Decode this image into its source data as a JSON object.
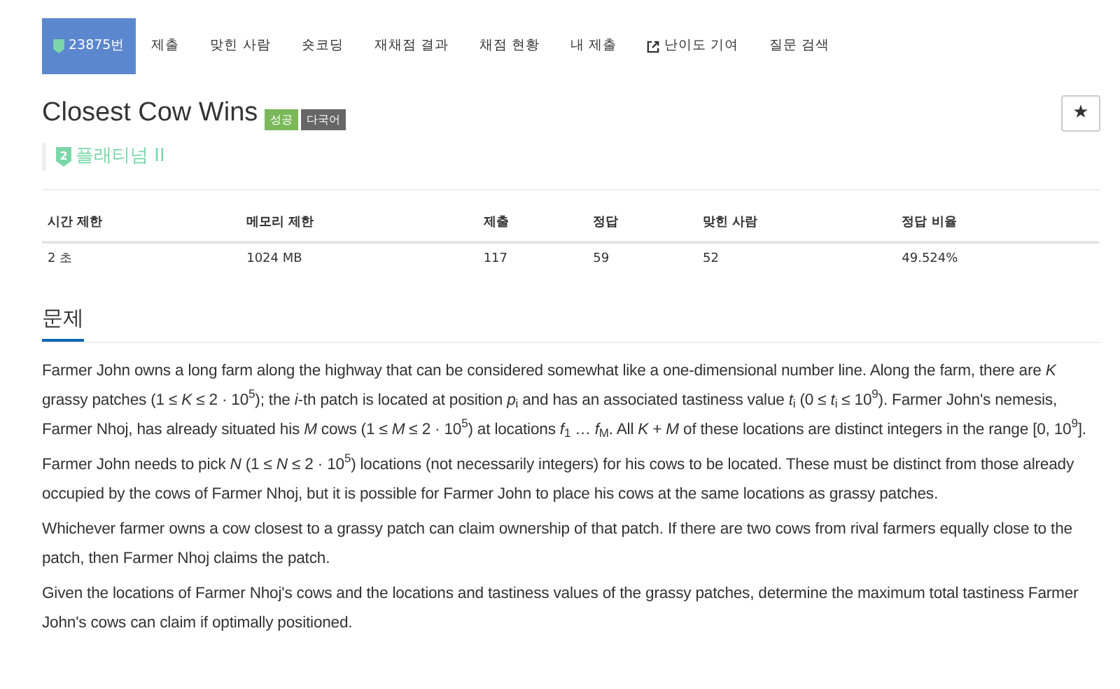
{
  "tabs": [
    {
      "label": "23875번",
      "selected": true,
      "kind": "problem"
    },
    {
      "label": "제출",
      "selected": false,
      "kind": "plain"
    },
    {
      "label": "맞힌 사람",
      "selected": false,
      "kind": "plain"
    },
    {
      "label": "숏코딩",
      "selected": false,
      "kind": "plain"
    },
    {
      "label": "재채점 결과",
      "selected": false,
      "kind": "plain"
    },
    {
      "label": "채점 현황",
      "selected": false,
      "kind": "plain"
    },
    {
      "label": "내 제출",
      "selected": false,
      "kind": "plain"
    },
    {
      "label": "난이도 기여",
      "selected": false,
      "kind": "external"
    },
    {
      "label": "질문 검색",
      "selected": false,
      "kind": "plain"
    }
  ],
  "title": "Closest Cow Wins",
  "badges": [
    {
      "label": "성공",
      "color": "#7ab85a"
    },
    {
      "label": "다국어",
      "color": "#666666"
    }
  ],
  "star_button": "★",
  "tier": {
    "label": "플래티넘 II",
    "icon_text": "2"
  },
  "table": {
    "columns": [
      "시간 제한",
      "메모리 제한",
      "제출",
      "정답",
      "맞힌 사람",
      "정답 비율"
    ],
    "rows": [
      [
        "2 초",
        "1024 MB",
        "117",
        "59",
        "52",
        "49.524%"
      ]
    ]
  },
  "section_title": "문제",
  "paragraphs": [
    "Farmer John owns a long farm along the highway that can be considered somewhat like a one-dimensional number line. Along the farm, there are *K* grassy patches (1 ≤ *K* ≤ 2 · 10$^{5}$); the *i*-th patch is located at position *p*$_{i}$ and has an associated tastiness value *t*$_{i}$ (0 ≤ *t*$_{i}$ ≤ 10$^{9}$). Farmer John's nemesis, Farmer Nhoj, has already situated his *M* cows (1 ≤ *M* ≤ 2 · 10$^{5}$) at locations *f*$_{1}$ … *f*$_{M}$. All *K* + *M* of these locations are distinct integers in the range [0, 10$^{9}$].",
    "Farmer John needs to pick *N* (1 ≤ *N* ≤ 2 · 10$^{5}$) locations (not necessarily integers) for his cows to be located. These must be distinct from those already occupied by the cows of Farmer Nhoj, but it is possible for Farmer John to place his cows at the same locations as grassy patches.",
    "Whichever farmer owns a cow closest to a grassy patch can claim ownership of that patch. If there are two cows from rival farmers equally close to the patch, then Farmer Nhoj claims the patch.",
    "Given the locations of Farmer Nhoj's cows and the locations and tastiness values of the grassy patches, determine the maximum total tastiness Farmer John's cows can claim if optimally positioned."
  ]
}
